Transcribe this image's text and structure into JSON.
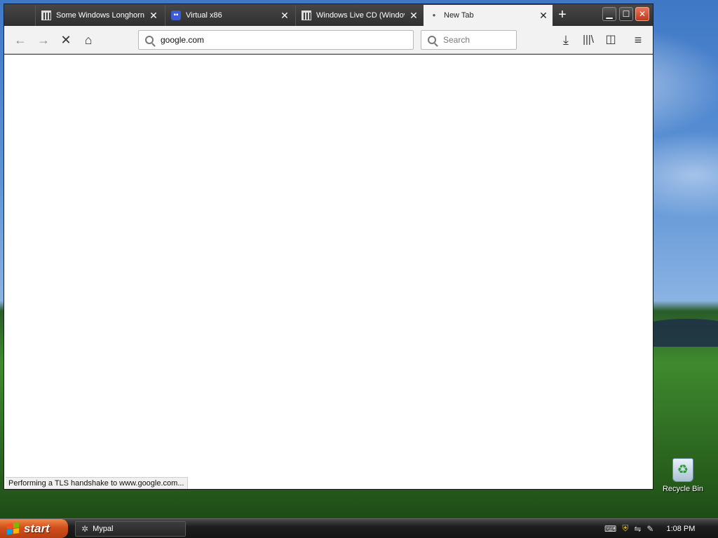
{
  "browser": {
    "tabs": [
      {
        "title": "Some Windows Longhorn",
        "icon": "museum-icon",
        "active": false
      },
      {
        "title": "Virtual x86",
        "icon": "virtual-x86-icon",
        "active": false
      },
      {
        "title": "Windows Live CD (Windov",
        "icon": "museum-icon",
        "active": false
      },
      {
        "title": "New Tab",
        "icon": "loading-dot-icon",
        "active": true
      }
    ],
    "new_tab_label": "+",
    "url": "google.com",
    "search_placeholder": "Search",
    "status_text": "Performing a TLS handshake to www.google.com..."
  },
  "desktop": {
    "recycle_bin_label": "Recycle Bin"
  },
  "taskbar": {
    "start_label": "start",
    "task_label": "Mypal",
    "clock": "1:08 PM"
  },
  "colors": {
    "tabstrip": "#3c3c3c",
    "navbar": "#f2f2f2",
    "start_button": "#d1501c",
    "close_button": "#c0391c"
  }
}
